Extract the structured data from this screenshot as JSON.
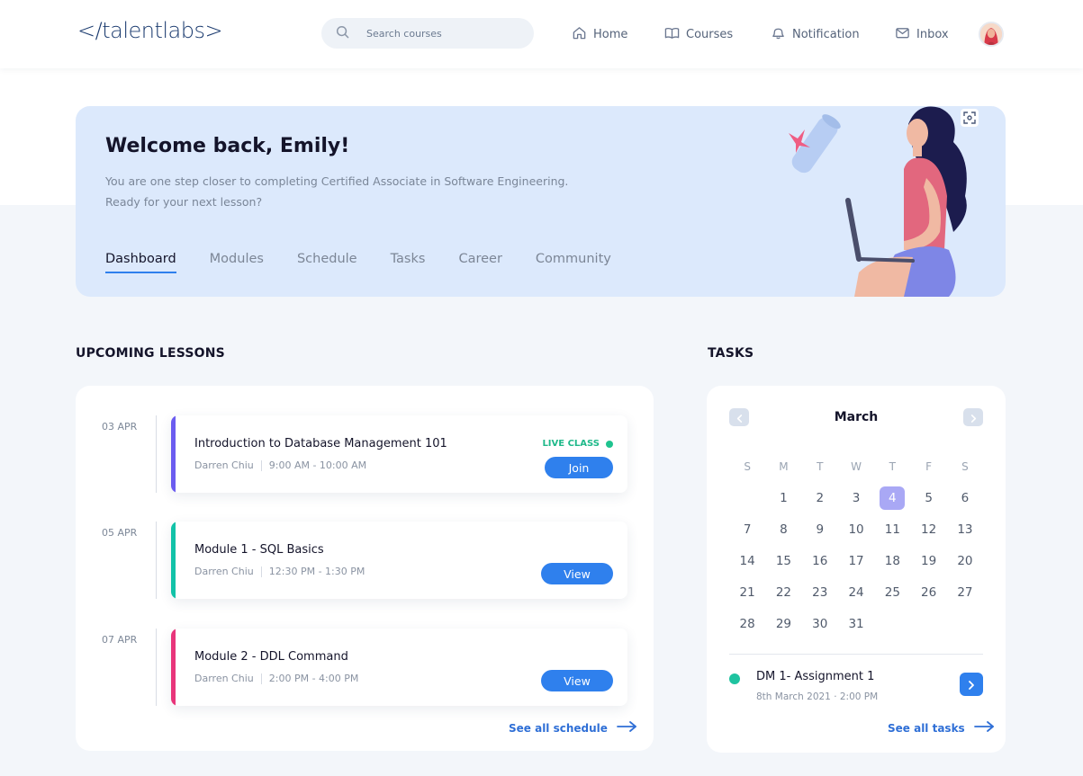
{
  "brand": {
    "logo": "</talentlabs>"
  },
  "search": {
    "placeholder": "Search courses"
  },
  "nav": {
    "home": "Home",
    "courses": "Courses",
    "notification": "Notification",
    "inbox": "Inbox"
  },
  "hero": {
    "title": "Welcome back, Emily!",
    "subtitle_line1": "You are one step closer to completing Certified Associate in Software Engineering.",
    "subtitle_line2": "Ready for your next lesson?",
    "tabs": [
      "Dashboard",
      "Modules",
      "Schedule",
      "Tasks",
      "Career",
      "Community"
    ],
    "active_tab": "Dashboard"
  },
  "lessons": {
    "section_title": "UPCOMING LESSONS",
    "items": [
      {
        "date": "03 APR",
        "title": "Introduction to Database Management 101",
        "instructor": "Darren Chiu",
        "time": "9:00 AM - 10:00 AM",
        "badge": "LIVE CLASS",
        "action": "Join",
        "accent": "#6b5cf0"
      },
      {
        "date": "05 APR",
        "title": "Module 1 - SQL Basics",
        "instructor": "Darren Chiu",
        "time": "12:30 PM - 1:30 PM",
        "badge": "",
        "action": "View",
        "accent": "#12c2a8"
      },
      {
        "date": "07 APR",
        "title": "Module 2 - DDL Command",
        "instructor": "Darren Chiu",
        "time": "2:00 PM - 4:00 PM",
        "badge": "",
        "action": "View",
        "accent": "#e8357a"
      }
    ],
    "see_all": "See all schedule"
  },
  "tasks": {
    "section_title": "TASKS",
    "calendar": {
      "month": "March",
      "weekdays": [
        "S",
        "M",
        "T",
        "W",
        "T",
        "F",
        "S"
      ],
      "leading_blanks": 1,
      "days": 31,
      "selected_day": 4
    },
    "items": [
      {
        "title": "DM 1- Assignment 1",
        "date": "8th March 2021 · 2:00 PM"
      }
    ],
    "see_all": "See all tasks"
  },
  "colors": {
    "accent": "#2f80ed",
    "hero_bg": "#dce9fc",
    "live": "#1fc38f",
    "selected_day": "#a9a8f5"
  }
}
